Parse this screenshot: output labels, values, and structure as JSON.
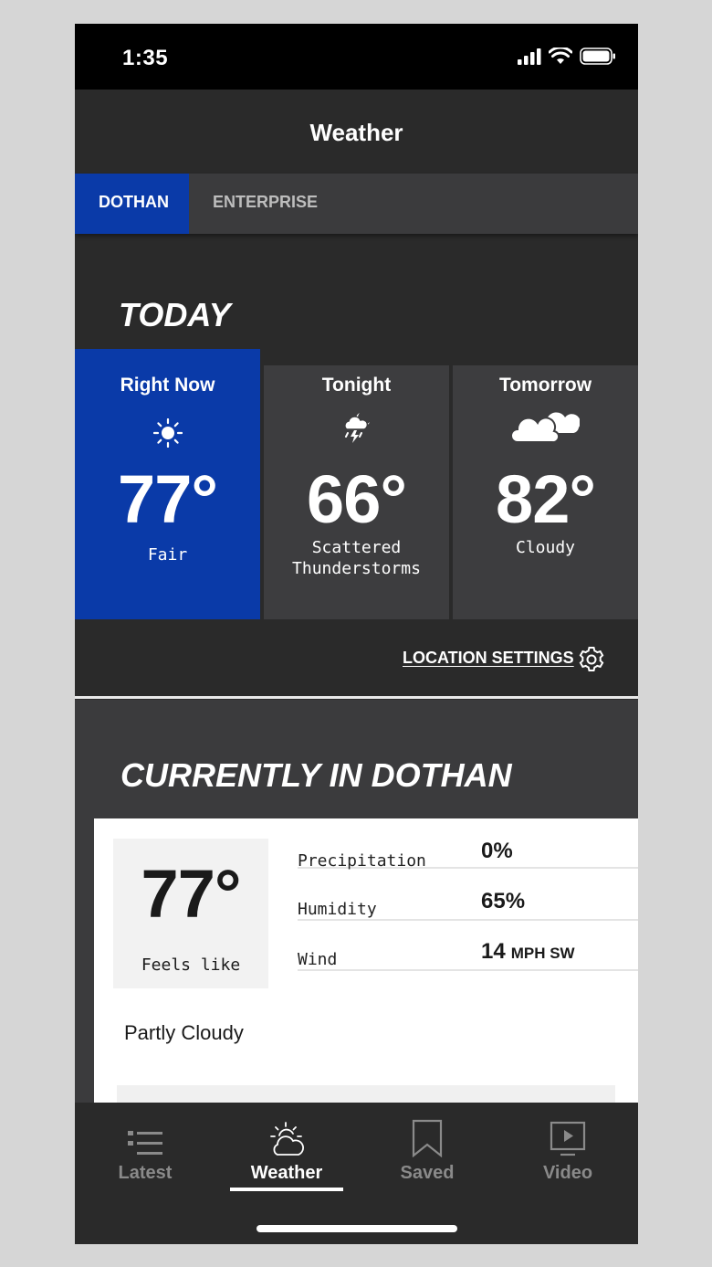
{
  "status": {
    "time": "1:35"
  },
  "header": {
    "title": "Weather"
  },
  "location_tabs": [
    {
      "label": "DOTHAN",
      "active": true
    },
    {
      "label": "ENTERPRISE",
      "active": false
    }
  ],
  "today": {
    "heading": "TODAY",
    "cards": [
      {
        "label": "Right Now",
        "icon": "sun-icon",
        "temp": "77°",
        "condition": "Fair"
      },
      {
        "label": "Tonight",
        "icon": "thunderstorm-icon",
        "temp": "66°",
        "condition_line1": "Scattered",
        "condition_line2": "Thunderstorms"
      },
      {
        "label": "Tomorrow",
        "icon": "cloudy-icon",
        "temp": "82°",
        "condition": "Cloudy"
      }
    ],
    "location_settings_label": "LOCATION SETTINGS"
  },
  "current": {
    "heading": "CURRENTLY IN DOTHAN",
    "feels_temp": "77°",
    "feels_label": "Feels like",
    "stats": [
      {
        "label": "Precipitation",
        "value": "0%",
        "unit": ""
      },
      {
        "label": "Humidity",
        "value": "65%",
        "unit": ""
      },
      {
        "label": "Wind",
        "value": "14",
        "unit": "MPH SW"
      }
    ],
    "condition": "Partly Cloudy"
  },
  "bottom_nav": [
    {
      "label": "Latest",
      "icon": "list-icon",
      "active": false
    },
    {
      "label": "Weather",
      "icon": "weather-icon",
      "active": true
    },
    {
      "label": "Saved",
      "icon": "bookmark-icon",
      "active": false
    },
    {
      "label": "Video",
      "icon": "video-icon",
      "active": false
    }
  ],
  "colors": {
    "accent": "#0a3aa8",
    "background": "#2a2a2a",
    "card": "#3d3d3f"
  }
}
